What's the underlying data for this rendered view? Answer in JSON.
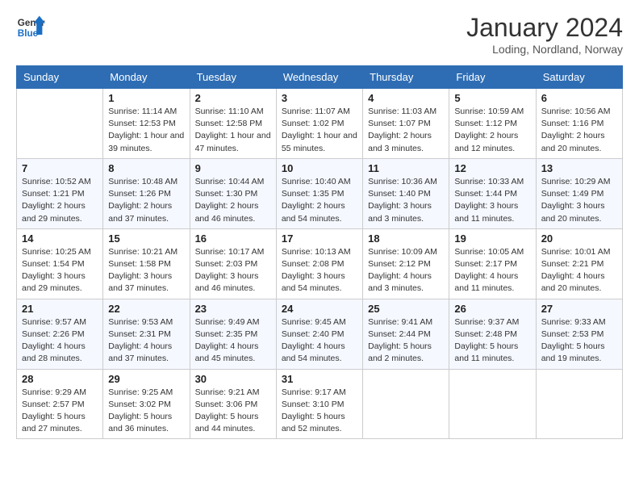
{
  "header": {
    "logo_line1": "General",
    "logo_line2": "Blue",
    "month_year": "January 2024",
    "location": "Loding, Nordland, Norway"
  },
  "weekdays": [
    "Sunday",
    "Monday",
    "Tuesday",
    "Wednesday",
    "Thursday",
    "Friday",
    "Saturday"
  ],
  "weeks": [
    [
      {
        "day": "",
        "info": ""
      },
      {
        "day": "1",
        "info": "Sunrise: 11:14 AM\nSunset: 12:53 PM\nDaylight: 1 hour and 39 minutes."
      },
      {
        "day": "2",
        "info": "Sunrise: 11:10 AM\nSunset: 12:58 PM\nDaylight: 1 hour and 47 minutes."
      },
      {
        "day": "3",
        "info": "Sunrise: 11:07 AM\nSunset: 1:02 PM\nDaylight: 1 hour and 55 minutes."
      },
      {
        "day": "4",
        "info": "Sunrise: 11:03 AM\nSunset: 1:07 PM\nDaylight: 2 hours and 3 minutes."
      },
      {
        "day": "5",
        "info": "Sunrise: 10:59 AM\nSunset: 1:12 PM\nDaylight: 2 hours and 12 minutes."
      },
      {
        "day": "6",
        "info": "Sunrise: 10:56 AM\nSunset: 1:16 PM\nDaylight: 2 hours and 20 minutes."
      }
    ],
    [
      {
        "day": "7",
        "info": "Sunrise: 10:52 AM\nSunset: 1:21 PM\nDaylight: 2 hours and 29 minutes."
      },
      {
        "day": "8",
        "info": "Sunrise: 10:48 AM\nSunset: 1:26 PM\nDaylight: 2 hours and 37 minutes."
      },
      {
        "day": "9",
        "info": "Sunrise: 10:44 AM\nSunset: 1:30 PM\nDaylight: 2 hours and 46 minutes."
      },
      {
        "day": "10",
        "info": "Sunrise: 10:40 AM\nSunset: 1:35 PM\nDaylight: 2 hours and 54 minutes."
      },
      {
        "day": "11",
        "info": "Sunrise: 10:36 AM\nSunset: 1:40 PM\nDaylight: 3 hours and 3 minutes."
      },
      {
        "day": "12",
        "info": "Sunrise: 10:33 AM\nSunset: 1:44 PM\nDaylight: 3 hours and 11 minutes."
      },
      {
        "day": "13",
        "info": "Sunrise: 10:29 AM\nSunset: 1:49 PM\nDaylight: 3 hours and 20 minutes."
      }
    ],
    [
      {
        "day": "14",
        "info": "Sunrise: 10:25 AM\nSunset: 1:54 PM\nDaylight: 3 hours and 29 minutes."
      },
      {
        "day": "15",
        "info": "Sunrise: 10:21 AM\nSunset: 1:58 PM\nDaylight: 3 hours and 37 minutes."
      },
      {
        "day": "16",
        "info": "Sunrise: 10:17 AM\nSunset: 2:03 PM\nDaylight: 3 hours and 46 minutes."
      },
      {
        "day": "17",
        "info": "Sunrise: 10:13 AM\nSunset: 2:08 PM\nDaylight: 3 hours and 54 minutes."
      },
      {
        "day": "18",
        "info": "Sunrise: 10:09 AM\nSunset: 2:12 PM\nDaylight: 4 hours and 3 minutes."
      },
      {
        "day": "19",
        "info": "Sunrise: 10:05 AM\nSunset: 2:17 PM\nDaylight: 4 hours and 11 minutes."
      },
      {
        "day": "20",
        "info": "Sunrise: 10:01 AM\nSunset: 2:21 PM\nDaylight: 4 hours and 20 minutes."
      }
    ],
    [
      {
        "day": "21",
        "info": "Sunrise: 9:57 AM\nSunset: 2:26 PM\nDaylight: 4 hours and 28 minutes."
      },
      {
        "day": "22",
        "info": "Sunrise: 9:53 AM\nSunset: 2:31 PM\nDaylight: 4 hours and 37 minutes."
      },
      {
        "day": "23",
        "info": "Sunrise: 9:49 AM\nSunset: 2:35 PM\nDaylight: 4 hours and 45 minutes."
      },
      {
        "day": "24",
        "info": "Sunrise: 9:45 AM\nSunset: 2:40 PM\nDaylight: 4 hours and 54 minutes."
      },
      {
        "day": "25",
        "info": "Sunrise: 9:41 AM\nSunset: 2:44 PM\nDaylight: 5 hours and 2 minutes."
      },
      {
        "day": "26",
        "info": "Sunrise: 9:37 AM\nSunset: 2:48 PM\nDaylight: 5 hours and 11 minutes."
      },
      {
        "day": "27",
        "info": "Sunrise: 9:33 AM\nSunset: 2:53 PM\nDaylight: 5 hours and 19 minutes."
      }
    ],
    [
      {
        "day": "28",
        "info": "Sunrise: 9:29 AM\nSunset: 2:57 PM\nDaylight: 5 hours and 27 minutes."
      },
      {
        "day": "29",
        "info": "Sunrise: 9:25 AM\nSunset: 3:02 PM\nDaylight: 5 hours and 36 minutes."
      },
      {
        "day": "30",
        "info": "Sunrise: 9:21 AM\nSunset: 3:06 PM\nDaylight: 5 hours and 44 minutes."
      },
      {
        "day": "31",
        "info": "Sunrise: 9:17 AM\nSunset: 3:10 PM\nDaylight: 5 hours and 52 minutes."
      },
      {
        "day": "",
        "info": ""
      },
      {
        "day": "",
        "info": ""
      },
      {
        "day": "",
        "info": ""
      }
    ]
  ]
}
